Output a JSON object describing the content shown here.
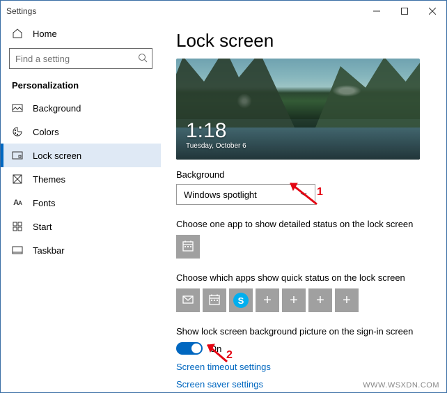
{
  "window": {
    "title": "Settings"
  },
  "sidebar": {
    "home_label": "Home",
    "search_placeholder": "Find a setting",
    "section_label": "Personalization",
    "items": [
      {
        "label": "Background"
      },
      {
        "label": "Colors"
      },
      {
        "label": "Lock screen"
      },
      {
        "label": "Themes"
      },
      {
        "label": "Fonts"
      },
      {
        "label": "Start"
      },
      {
        "label": "Taskbar"
      }
    ]
  },
  "main": {
    "page_title": "Lock screen",
    "preview": {
      "time": "1:18",
      "date": "Tuesday, October 6"
    },
    "background_label": "Background",
    "background_value": "Windows spotlight",
    "detail_status_label": "Choose one app to show detailed status on the lock screen",
    "quick_status_label": "Choose which apps show quick status on the lock screen",
    "signin_toggle_label": "Show lock screen background picture on the sign-in screen",
    "toggle_state": "On",
    "links": {
      "timeout": "Screen timeout settings",
      "saver": "Screen saver settings"
    }
  },
  "annotations": {
    "num1": "1",
    "num2": "2"
  },
  "watermark": "WWW.WSXDN.COM"
}
